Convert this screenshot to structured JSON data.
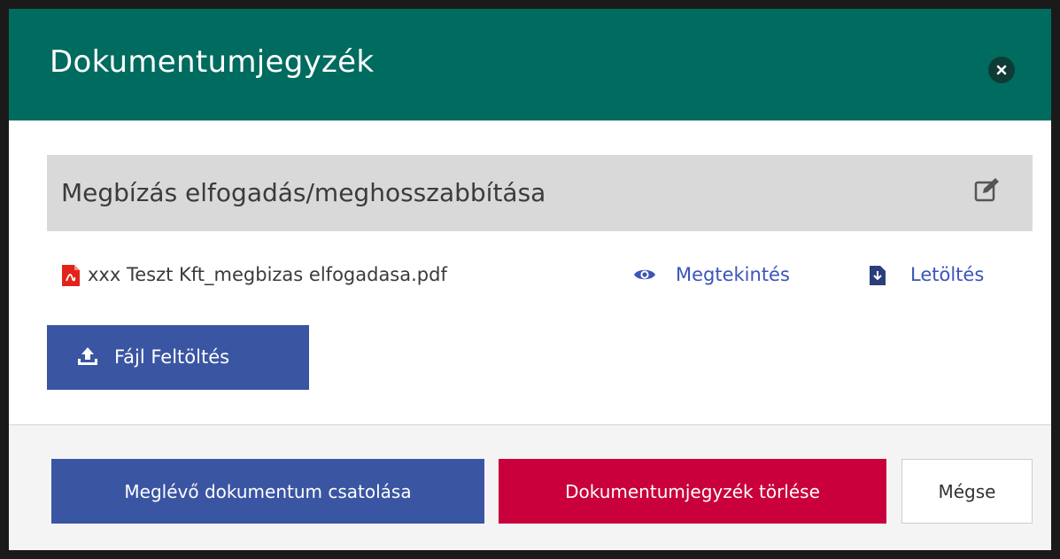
{
  "modal": {
    "title": "Dokumentumjegyzék"
  },
  "section": {
    "title": "Megbízás elfogadás/meghosszabbítása"
  },
  "file": {
    "name": "xxx Teszt Kft_megbizas elfogadasa.pdf",
    "view_label": "Megtekintés",
    "download_label": "Letöltés"
  },
  "upload": {
    "label": "Fájl Feltöltés"
  },
  "footer": {
    "attach_label": "Meglévő dokumentum csatolása",
    "delete_label": "Dokumentumjegyzék törlése",
    "cancel_label": "Mégse"
  },
  "icons": {
    "close": "close-icon",
    "edit": "edit-icon",
    "pdf": "pdf-file-icon",
    "view": "eye-icon",
    "download": "download-file-icon",
    "upload": "upload-icon"
  },
  "colors": {
    "header": "#006b5f",
    "primary": "#3a55a2",
    "danger": "#c9003c",
    "link": "#3b55b8",
    "pdf": "#e2231a"
  }
}
